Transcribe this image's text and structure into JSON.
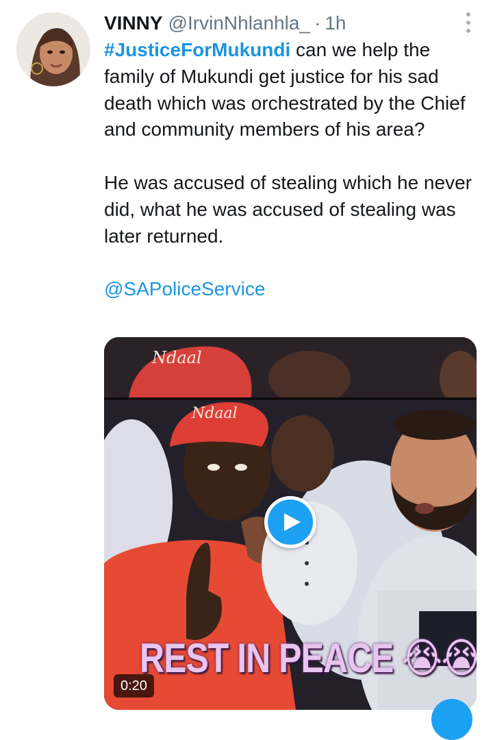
{
  "tweet": {
    "display_name": "VINNY",
    "handle": "@IrvinNhlanhla_",
    "separator": "·",
    "time": "1h",
    "hashtag": "#JusticeForMukundi",
    "text_part1": " can we help the family of Mukundi get justice for his sad death which was orchestrated by the Chief and community members of his area?",
    "text_part2": "He was accused of stealing which he never did, what he was accused of stealing was later returned.",
    "mention": "@SAPoliceService"
  },
  "media": {
    "type": "video",
    "duration": "0:20",
    "overlay_text": "REST IN PEACE",
    "cap_text": "Ndaal",
    "emoji": "😭😭",
    "play_icon": "play-icon"
  },
  "icons": {
    "more": "more-vertical-icon",
    "compose": "compose-fab-icon"
  },
  "colors": {
    "link": "#1b95e0",
    "secondary_text": "#657786",
    "play_button": "#1da1f2"
  }
}
